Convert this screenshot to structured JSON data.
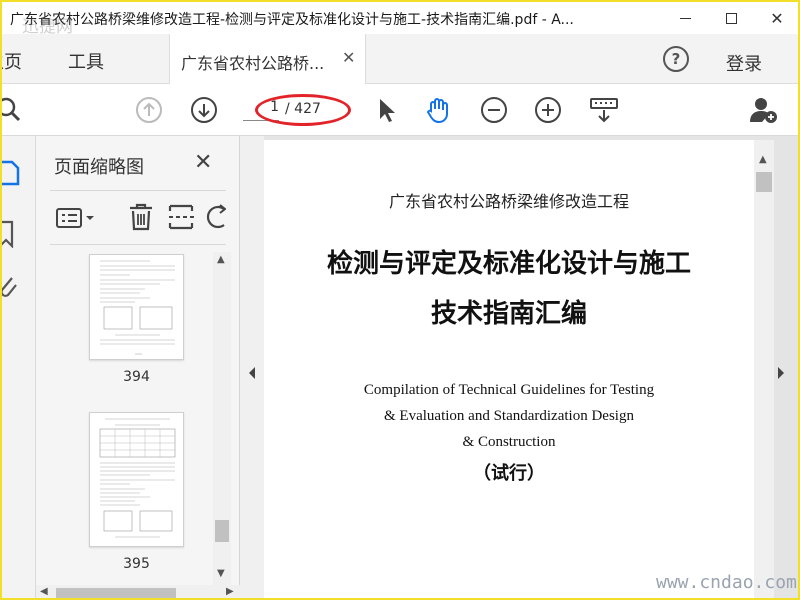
{
  "window": {
    "title": "广东省农村公路桥梁维修改造工程-检测与评定及标准化设计与施工-技术指南汇编.pdf - A...",
    "watermark_top": "迅捷网"
  },
  "tabs": {
    "home": "主页",
    "tools": "工具",
    "document": "广东省农村公路桥...",
    "login": "登录"
  },
  "toolbar": {
    "current_page": "1",
    "total_pages": "/ 427"
  },
  "thumbnails": {
    "title": "页面缩略图",
    "items": [
      {
        "page": "394"
      },
      {
        "page": "395"
      }
    ]
  },
  "page_content": {
    "line1": "广东省农村公路桥梁维修改造工程",
    "heading1": "检测与评定及标准化设计与施工",
    "heading2": "技术指南汇编",
    "english": [
      "Compilation of Technical Guidelines for Testing",
      "& Evaluation and Standardization Design",
      "& Construction"
    ],
    "trial": "（试行）"
  },
  "watermark": "www.cndao.com",
  "colors": {
    "accent_blue": "#1473e6",
    "highlight_red": "#e2242a",
    "frame_yellow": "#f1df2a"
  }
}
